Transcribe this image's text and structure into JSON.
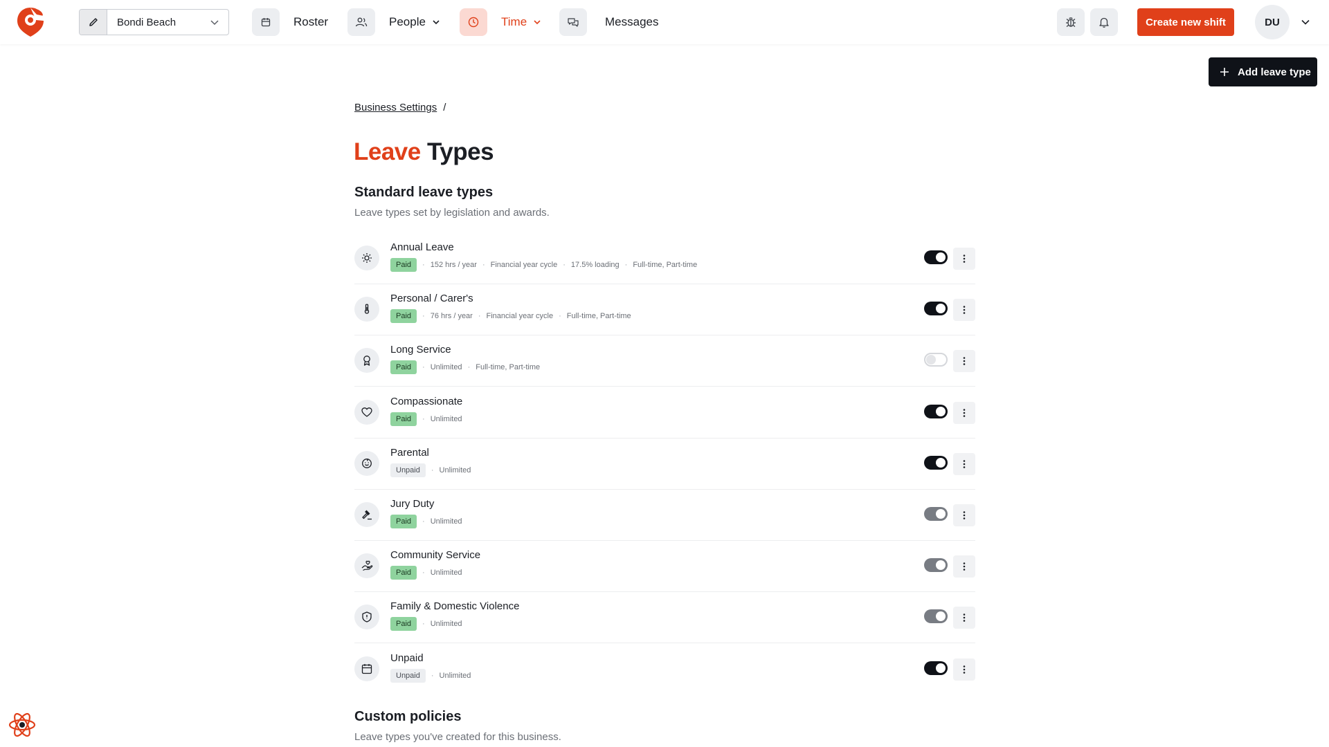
{
  "header": {
    "location": "Bondi Beach",
    "nav": {
      "roster": "Roster",
      "people": "People",
      "time": "Time",
      "messages": "Messages"
    },
    "create_shift": "Create new shift",
    "avatar_initials": "DU"
  },
  "actions": {
    "add_leave_type": "Add leave type"
  },
  "breadcrumb": {
    "parent": "Business Settings",
    "separator": "/"
  },
  "title": {
    "accent": "Leave",
    "rest": " Types"
  },
  "standard": {
    "heading": "Standard leave types",
    "subheading": "Leave types set by legislation and awards.",
    "items": [
      {
        "name": "Annual Leave",
        "badge": "Paid",
        "meta": [
          "152 hrs / year",
          "Financial year cycle",
          "17.5% loading",
          "Full-time, Part-time"
        ],
        "toggle": "on",
        "icon": "sun-icon"
      },
      {
        "name": "Personal / Carer's",
        "badge": "Paid",
        "meta": [
          "76 hrs / year",
          "Financial year cycle",
          "Full-time, Part-time"
        ],
        "toggle": "on",
        "icon": "thermometer-icon"
      },
      {
        "name": "Long Service",
        "badge": "Paid",
        "meta": [
          "Unlimited",
          "Full-time, Part-time"
        ],
        "toggle": "off",
        "icon": "award-icon"
      },
      {
        "name": "Compassionate",
        "badge": "Paid",
        "meta": [
          "Unlimited"
        ],
        "toggle": "on",
        "icon": "heart-icon"
      },
      {
        "name": "Parental",
        "badge": "Unpaid",
        "meta": [
          "Unlimited"
        ],
        "toggle": "on",
        "icon": "baby-icon"
      },
      {
        "name": "Jury Duty",
        "badge": "Paid",
        "meta": [
          "Unlimited"
        ],
        "toggle": "mid",
        "icon": "gavel-icon"
      },
      {
        "name": "Community Service",
        "badge": "Paid",
        "meta": [
          "Unlimited"
        ],
        "toggle": "mid",
        "icon": "helping-hand-icon"
      },
      {
        "name": "Family & Domestic Violence",
        "badge": "Paid",
        "meta": [
          "Unlimited"
        ],
        "toggle": "mid",
        "icon": "shield-icon"
      },
      {
        "name": "Unpaid",
        "badge": "Unpaid",
        "meta": [
          "Unlimited"
        ],
        "toggle": "on",
        "icon": "calendar-icon"
      }
    ]
  },
  "custom": {
    "heading": "Custom policies",
    "subheading": "Leave types you've created for this business."
  },
  "colors": {
    "accent": "#e0401a",
    "paid": "#8fd39e",
    "dark": "#0f1218"
  }
}
